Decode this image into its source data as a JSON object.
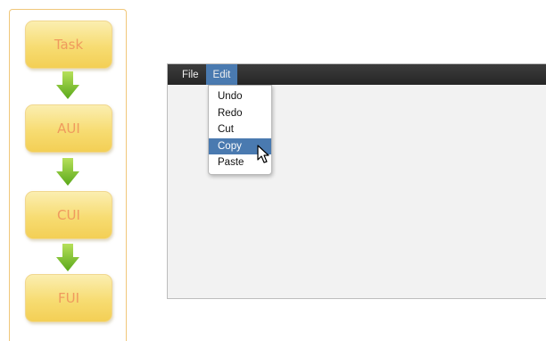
{
  "flow": {
    "stages": [
      {
        "label": "Task"
      },
      {
        "label": "AUI"
      },
      {
        "label": "CUI"
      },
      {
        "label": "FUI"
      }
    ]
  },
  "app": {
    "menus": [
      {
        "label": "File"
      },
      {
        "label": "Edit"
      }
    ],
    "edit_menu": {
      "items": [
        {
          "label": "Undo"
        },
        {
          "label": "Redo"
        },
        {
          "label": "Cut"
        },
        {
          "label": "Copy"
        },
        {
          "label": "Paste"
        }
      ],
      "selected": "Copy"
    }
  },
  "colors": {
    "stage_text": "#ef9a5e",
    "highlight": "#4a7ab0",
    "arrow": "#7cc326",
    "menubar": "#2b2b2b"
  }
}
